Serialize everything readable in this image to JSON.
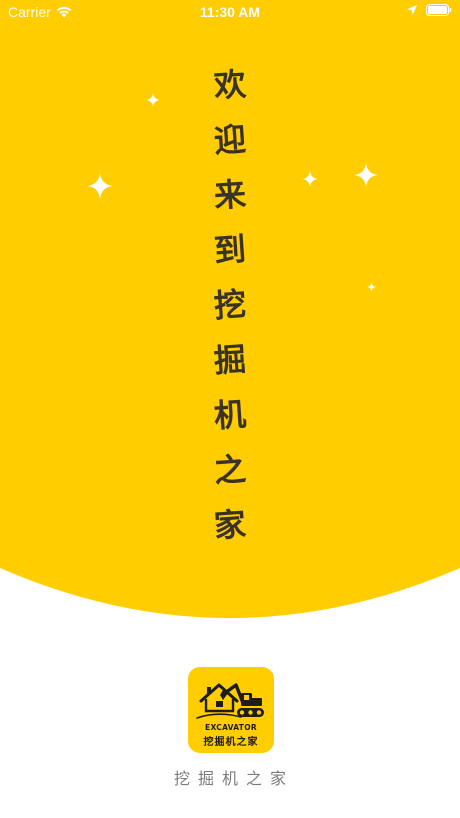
{
  "status_bar": {
    "carrier": "Carrier",
    "time": "11:30 AM",
    "icons": [
      "wifi-icon",
      "location-arrow-icon",
      "battery-icon"
    ]
  },
  "welcome": {
    "characters": [
      "欢",
      "迎",
      "来",
      "到",
      "挖",
      "掘",
      "机",
      "之",
      "家"
    ]
  },
  "logo": {
    "english_text": "EXCAVATOR",
    "chinese_text": "挖掘机之家",
    "icon": "excavator-house-icon"
  },
  "app_name": "挖掘机之家",
  "colors": {
    "primary_yellow": "#ffcd00",
    "sparkle": "#ffffff",
    "calligraphy_text": "#3a3324",
    "caption_gray": "#7c7c7c",
    "logo_dark": "#1d1d1d"
  }
}
